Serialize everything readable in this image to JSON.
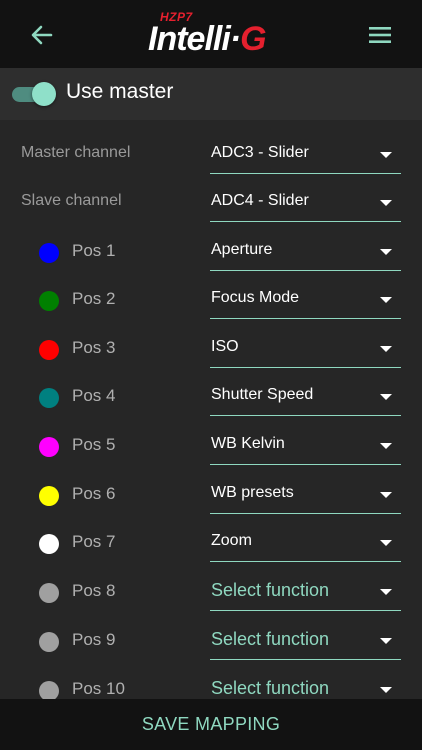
{
  "header": {
    "logo_sub": "HZP7",
    "logo_main": "Intelli",
    "logo_dot": "·",
    "logo_g": "G",
    "back_icon": "arrow-left-icon",
    "menu_icon": "hamburger-menu-icon"
  },
  "master": {
    "label": "Use master",
    "enabled": true
  },
  "channels": {
    "master_label": "Master channel",
    "master_value": "ADC3 - Slider",
    "slave_label": "Slave channel",
    "slave_value": "ADC4 - Slider"
  },
  "positions": [
    {
      "label": "Pos 1",
      "color": "#0000ff",
      "value": "Aperture"
    },
    {
      "label": "Pos 2",
      "color": "#008000",
      "value": "Focus Mode"
    },
    {
      "label": "Pos 3",
      "color": "#ff0000",
      "value": "ISO"
    },
    {
      "label": "Pos 4",
      "color": "#008080",
      "value": "Shutter Speed"
    },
    {
      "label": "Pos 5",
      "color": "#ff00ff",
      "value": "WB Kelvin"
    },
    {
      "label": "Pos 6",
      "color": "#ffff00",
      "value": "WB presets"
    },
    {
      "label": "Pos 7",
      "color": "#ffffff",
      "value": "Zoom"
    },
    {
      "label": "Pos 8",
      "color": "#a0a0a0",
      "value": "Select function"
    },
    {
      "label": "Pos 9",
      "color": "#a0a0a0",
      "value": "Select function"
    },
    {
      "label": "Pos 10",
      "color": "#a0a0a0",
      "value": "Select function"
    }
  ],
  "footer": {
    "save_label": "SAVE MAPPING"
  },
  "colors": {
    "accent": "#8fd8c0",
    "brand_red": "#e5202e",
    "background": "#262626",
    "bar": "#121212"
  }
}
